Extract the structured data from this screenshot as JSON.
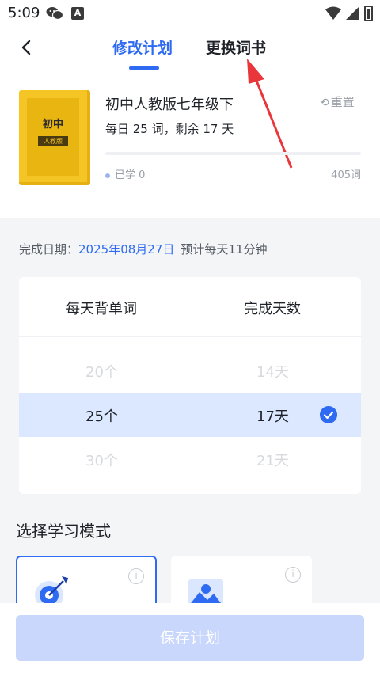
{
  "status": {
    "time": "5:09",
    "a_badge": "A"
  },
  "tabs": {
    "active": "修改计划",
    "inactive": "更换词书"
  },
  "book": {
    "cover_title": "初中",
    "cover_label": "人教版",
    "name": "初中人教版七年级下",
    "summary": "每日 25 词，剩余 17 天",
    "reset_label": "重置",
    "learned_label": "已学 0",
    "total_label": "405词",
    "progress": 0
  },
  "finish": {
    "label": "完成日期：",
    "date": "2025年08月27日",
    "estimate": "预计每天11分钟"
  },
  "picker": {
    "header_left": "每天背单词",
    "header_right": "完成天数",
    "rows": [
      {
        "left": "20个",
        "right": "14天"
      },
      {
        "left": "25个",
        "right": "17天"
      },
      {
        "left": "30个",
        "right": "21天"
      }
    ]
  },
  "mode": {
    "title": "选择学习模式",
    "info_glyph": "i"
  },
  "footer": {
    "save_label": "保存计划"
  },
  "colors": {
    "accent": "#2f6bf2",
    "arrow": "#e8363a",
    "book": "#f4c524",
    "selected_row": "#dbe8ff",
    "disabled_button": "#c8d7fb"
  }
}
